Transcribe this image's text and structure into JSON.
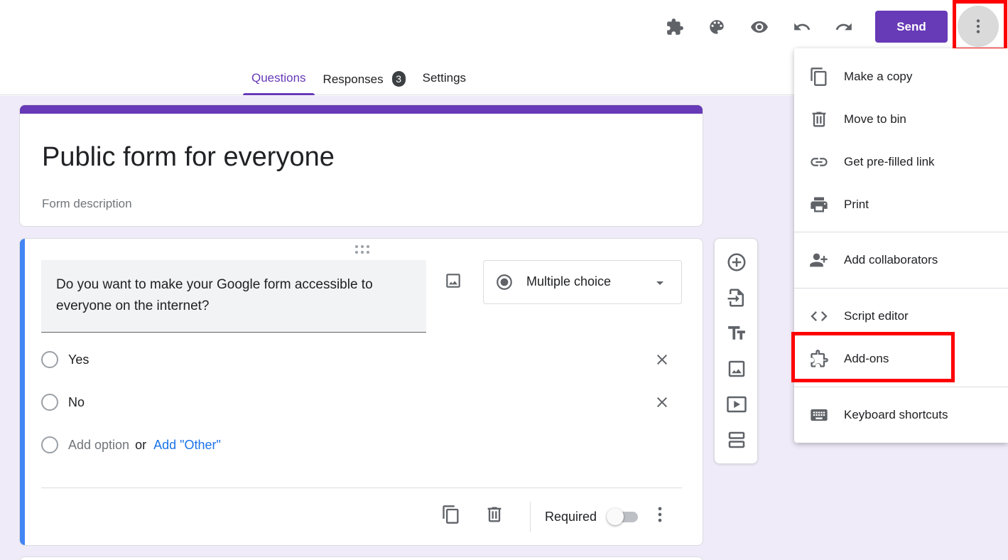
{
  "toolbar": {
    "addons_icon": "puzzle-icon",
    "theme_icon": "palette-icon",
    "preview_icon": "eye-icon",
    "undo_icon": "undo-icon",
    "redo_icon": "redo-icon",
    "send_label": "Send",
    "more_icon": "more-vert-icon",
    "accent_color": "#673ab7"
  },
  "tabs": [
    {
      "label": "Questions",
      "active": true
    },
    {
      "label": "Responses",
      "badge": "3"
    },
    {
      "label": "Settings"
    }
  ],
  "form": {
    "title": "Public form for everyone",
    "description": "Form description"
  },
  "question": {
    "text": "Do you want to make your Google form accessible to everyone  on the internet?",
    "type": "Multiple choice",
    "options": [
      "Yes",
      "No"
    ],
    "add_option": "Add option",
    "or_text": "or",
    "add_other": "Add \"Other\"",
    "required_label": "Required",
    "required": false
  },
  "side_toolbar": [
    "add-question-icon",
    "import-questions-icon",
    "add-title-icon",
    "add-image-icon",
    "add-video-icon",
    "add-section-icon"
  ],
  "menu": {
    "items": [
      {
        "label": "Make a copy",
        "icon": "copy-icon"
      },
      {
        "label": "Move to bin",
        "icon": "trash-icon"
      },
      {
        "label": "Get pre-filled link",
        "icon": "link-icon"
      },
      {
        "label": "Print",
        "icon": "print-icon"
      },
      {
        "label": "Add collaborators",
        "icon": "add-people-icon"
      },
      {
        "label": "Script editor",
        "icon": "code-icon"
      },
      {
        "label": "Add-ons",
        "icon": "puzzle-icon"
      },
      {
        "label": "Keyboard shortcuts",
        "icon": "keyboard-icon"
      }
    ]
  },
  "highlight_color": "#ff0000"
}
